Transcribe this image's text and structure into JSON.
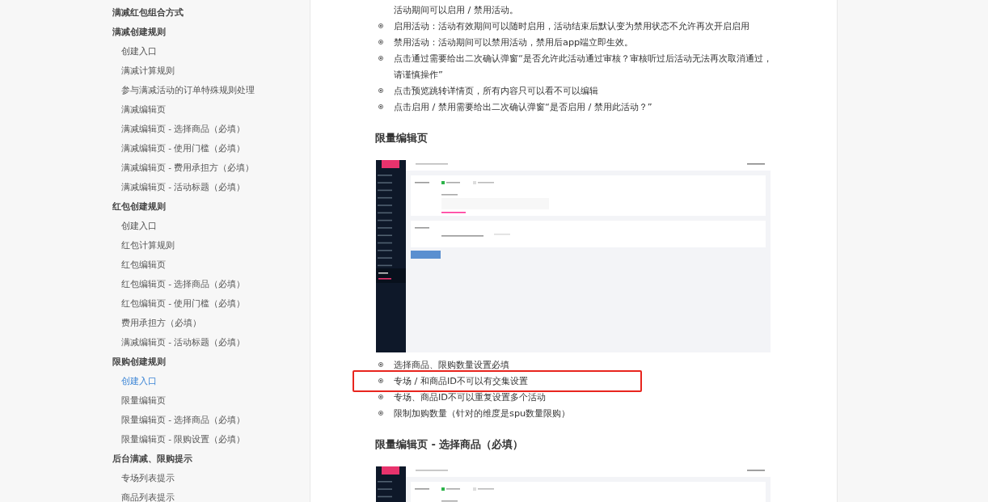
{
  "sidebar": {
    "items": [
      {
        "kind": "group",
        "label": "满减红包组合方式",
        "selected": false
      },
      {
        "kind": "group",
        "label": "满减创建规则",
        "selected": false
      },
      {
        "kind": "item",
        "label": "创建入口",
        "selected": false
      },
      {
        "kind": "item",
        "label": "满减计算规则",
        "selected": false
      },
      {
        "kind": "item",
        "label": "参与满减活动的订单特殊规则处理",
        "selected": false
      },
      {
        "kind": "item",
        "label": "满减编辑页",
        "selected": false
      },
      {
        "kind": "item",
        "label": "满减编辑页 - 选择商品（必填）",
        "selected": false
      },
      {
        "kind": "item",
        "label": "满减编辑页 - 使用门槛（必填）",
        "selected": false
      },
      {
        "kind": "item",
        "label": "满减编辑页 - 费用承担方（必填）",
        "selected": false
      },
      {
        "kind": "item",
        "label": "满减编辑页 - 活动标题（必填）",
        "selected": false
      },
      {
        "kind": "group",
        "label": "红包创建规则",
        "selected": false
      },
      {
        "kind": "item",
        "label": "创建入口",
        "selected": false
      },
      {
        "kind": "item",
        "label": "红包计算规则",
        "selected": false
      },
      {
        "kind": "item",
        "label": "红包编辑页",
        "selected": false
      },
      {
        "kind": "item",
        "label": "红包编辑页 - 选择商品（必填）",
        "selected": false
      },
      {
        "kind": "item",
        "label": "红包编辑页 - 使用门槛（必填）",
        "selected": false
      },
      {
        "kind": "item",
        "label": "费用承担方（必填）",
        "selected": false
      },
      {
        "kind": "item",
        "label": "满减编辑页 - 活动标题（必填）",
        "selected": false
      },
      {
        "kind": "group",
        "label": "限购创建规则",
        "selected": false
      },
      {
        "kind": "item",
        "label": "创建入口",
        "selected": true
      },
      {
        "kind": "item",
        "label": "限量编辑页",
        "selected": false
      },
      {
        "kind": "item",
        "label": "限量编辑页 - 选择商品（必填）",
        "selected": false
      },
      {
        "kind": "item",
        "label": "限量编辑页 - 限购设置（必填）",
        "selected": false
      },
      {
        "kind": "group",
        "label": "后台满减、限购提示",
        "selected": false
      },
      {
        "kind": "item",
        "label": "专场列表提示",
        "selected": false
      },
      {
        "kind": "item",
        "label": "商品列表提示",
        "selected": false
      }
    ]
  },
  "content": [
    {
      "kind": "bullets",
      "items": [
        {
          "text": "活动期间可以启用 / 禁用活动。",
          "continuation": true,
          "highlighted": false
        },
        {
          "text": "启用活动：活动有效期间可以随时启用，活动结束后默认变为禁用状态不允许再次开启启用",
          "continuation": false,
          "highlighted": false
        },
        {
          "text": "禁用活动：活动期间可以禁用活动，禁用后app端立即生效。",
          "continuation": false,
          "highlighted": false
        },
        {
          "text": "点击通过需要给出二次确认弹窗“是否允许此活动通过审核？审核听过后活动无法再次取消通过，请谨慎操作”",
          "continuation": false,
          "highlighted": false
        },
        {
          "text": "点击预览跳转详情页，所有内容只可以看不可以编辑",
          "continuation": false,
          "highlighted": false
        },
        {
          "text": "点击启用 / 禁用需要给出二次确认弹窗“是否启用 / 禁用此活动？”",
          "continuation": false,
          "highlighted": false
        }
      ]
    },
    {
      "kind": "heading",
      "text": "限量编辑页"
    },
    {
      "kind": "screenshot"
    },
    {
      "kind": "bullets",
      "items": [
        {
          "text": "选择商品、限购数量设置必填",
          "continuation": false,
          "highlighted": false
        },
        {
          "text": "专场 / 和商品ID不可以有交集设置",
          "continuation": false,
          "highlighted": true
        },
        {
          "text": "专场、商品ID不可以重复设置多个活动",
          "continuation": false,
          "highlighted": false
        },
        {
          "text": "限制加购数量（针对的维度是spu数量限购）",
          "continuation": false,
          "highlighted": false
        }
      ]
    },
    {
      "kind": "heading",
      "text": "限量编辑页 - 选择商品（必填）"
    },
    {
      "kind": "screenshot"
    }
  ]
}
